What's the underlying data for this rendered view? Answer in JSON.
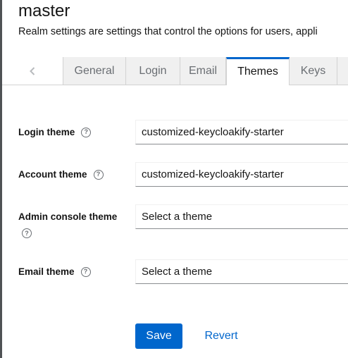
{
  "header": {
    "realm_name": "master",
    "description": "Realm settings are settings that control the options for users, appli"
  },
  "tabs": [
    {
      "label": "General",
      "active": false
    },
    {
      "label": "Login",
      "active": false
    },
    {
      "label": "Email",
      "active": false
    },
    {
      "label": "Themes",
      "active": true
    },
    {
      "label": "Keys",
      "active": false
    }
  ],
  "icons": {
    "scroll_left": "chevron-left-icon",
    "help": "question-circle-icon"
  },
  "form": {
    "login_theme": {
      "label": "Login theme",
      "value": "customized-keycloakify-starter"
    },
    "account_theme": {
      "label": "Account theme",
      "value": "customized-keycloakify-starter"
    },
    "admin_console_theme": {
      "label": "Admin console theme",
      "value": "Select a theme"
    },
    "email_theme": {
      "label": "Email theme",
      "value": "Select a theme"
    }
  },
  "actions": {
    "save_label": "Save",
    "revert_label": "Revert"
  },
  "colors": {
    "accent": "#0066cc",
    "text": "#151515",
    "muted": "#6a6e73"
  }
}
